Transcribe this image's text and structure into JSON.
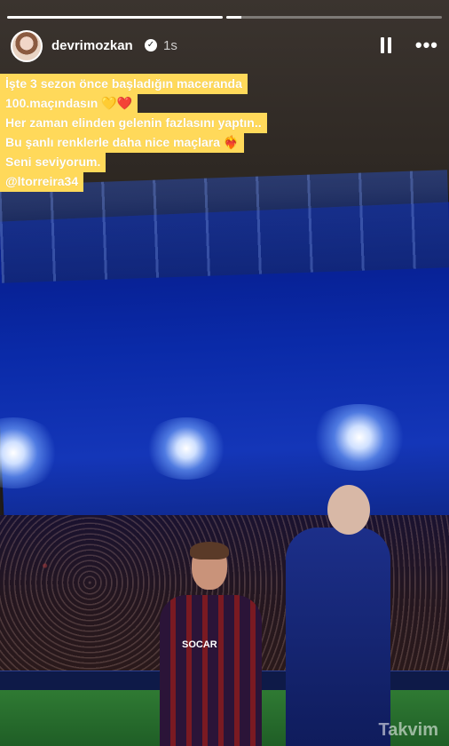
{
  "story": {
    "progress": [
      1.0,
      0.07
    ],
    "user": {
      "username": "devrimozkan",
      "time_ago": "1s",
      "verified_icon": "check-badge-icon"
    },
    "controls": {
      "pause_icon": "pause-icon",
      "more_label": "•••"
    }
  },
  "caption": {
    "lines": [
      "İşte 3 sezon önce başladığın maceranda",
      "100.maçındasın",
      "Her zaman elinden gelenin fazlasını yaptın..",
      "Bu şanlı renklerle daha nice maçlara",
      "Seni seviyorum.",
      "@ltorreira34"
    ],
    "emoji": {
      "line2": "💛❤️",
      "line4": "❤️‍🔥"
    }
  },
  "photo": {
    "shirt_sponsor": "SOCAR"
  },
  "watermark": "Takvim"
}
